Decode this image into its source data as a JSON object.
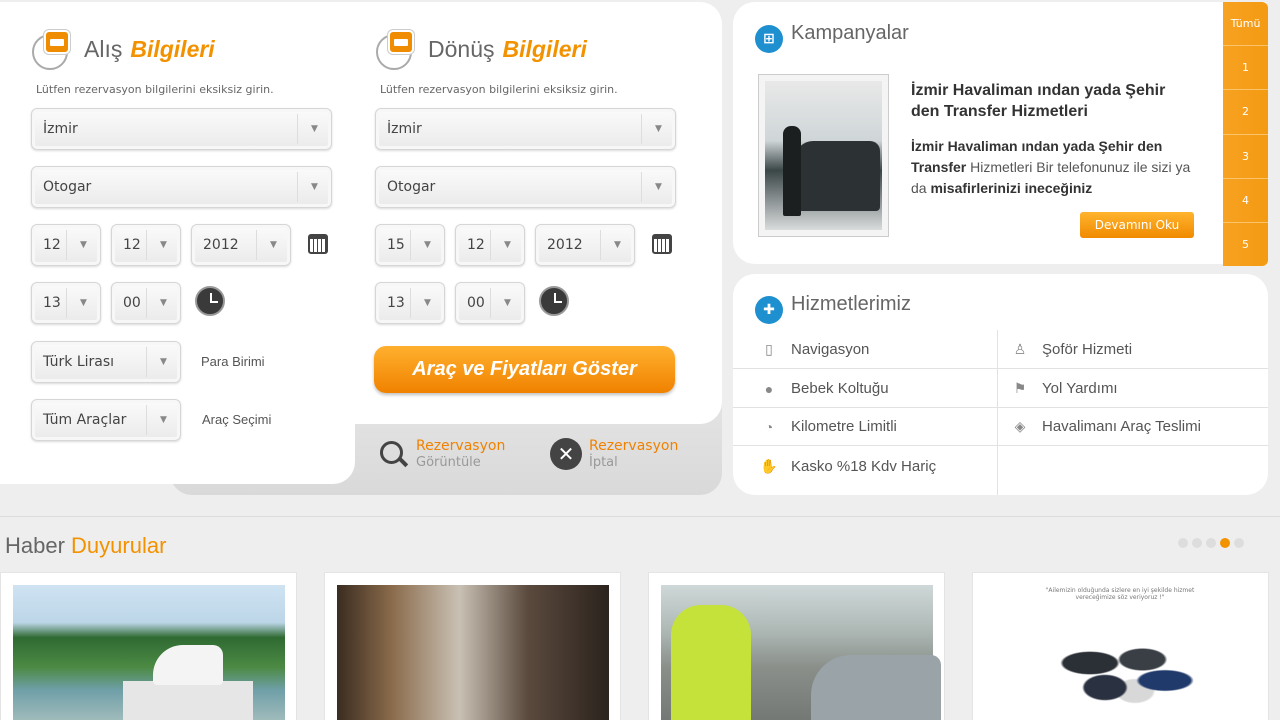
{
  "pickup": {
    "title_light": "Alış",
    "title_bold": "Bilgileri",
    "hint": "Lütfen rezervasyon bilgilerini eksiksiz girin.",
    "city": "İzmir",
    "location": "Otogar",
    "day": "12",
    "month": "12",
    "year": "2012",
    "hour": "13",
    "minute": "00",
    "currency": "Türk Lirası",
    "currency_label": "Para Birimi",
    "vehicle": "Tüm Araçlar",
    "vehicle_label": "Araç Seçimi"
  },
  "return": {
    "title_light": "Dönüş",
    "title_bold": "Bilgileri",
    "hint": "Lütfen rezervasyon bilgilerini eksiksiz girin.",
    "city": "İzmir",
    "location": "Otogar",
    "day": "15",
    "month": "12",
    "year": "2012",
    "hour": "13",
    "minute": "00"
  },
  "show_button": "Araç ve Fiyatları Göster",
  "reservation_view": {
    "line1": "Rezervasyon",
    "line2": "Görüntüle"
  },
  "reservation_cancel": {
    "line1": "Rezervasyon",
    "line2": "İptal"
  },
  "campaigns": {
    "title": "Kampanyalar",
    "headline": "İzmir Havaliman ından yada Şehir den Transfer Hizmetleri",
    "body_bold1": "İzmir Havaliman ından yada Şehir den Transfer",
    "body_text1": " Hizmetleri Bir telefonunuz ile sizi ya da ",
    "body_bold2": "misafirlerinizi ineceğiniz",
    "more_button": "Devamını Oku",
    "pager": [
      "Tümü",
      "1",
      "2",
      "3",
      "4",
      "5"
    ]
  },
  "services": {
    "title": "Hizmetlerimiz",
    "items": [
      {
        "label": "Navigasyon",
        "icon": "tablet-icon"
      },
      {
        "label": "Şoför Hizmeti",
        "icon": "driver-icon"
      },
      {
        "label": "Bebek Koltuğu",
        "icon": "pin-icon"
      },
      {
        "label": "Yol Yardımı",
        "icon": "flag-icon"
      },
      {
        "label": "Kilometre Limitli",
        "icon": "stopwatch-icon"
      },
      {
        "label": "Havalimanı Araç Teslimi",
        "icon": "car-icon"
      },
      {
        "label": "Kasko %18 Kdv Hariç",
        "icon": "thumbs-up-icon"
      }
    ]
  },
  "news": {
    "title_light": "Haber",
    "title_accent": "Duyurular",
    "card4_caption": "\"Ailemizin olduğunda sizlere en iyi şekilde hizmet vereceğimize söz veriyoruz !\""
  },
  "colors": {
    "accent": "#f39200",
    "blue": "#1e8fcf"
  }
}
